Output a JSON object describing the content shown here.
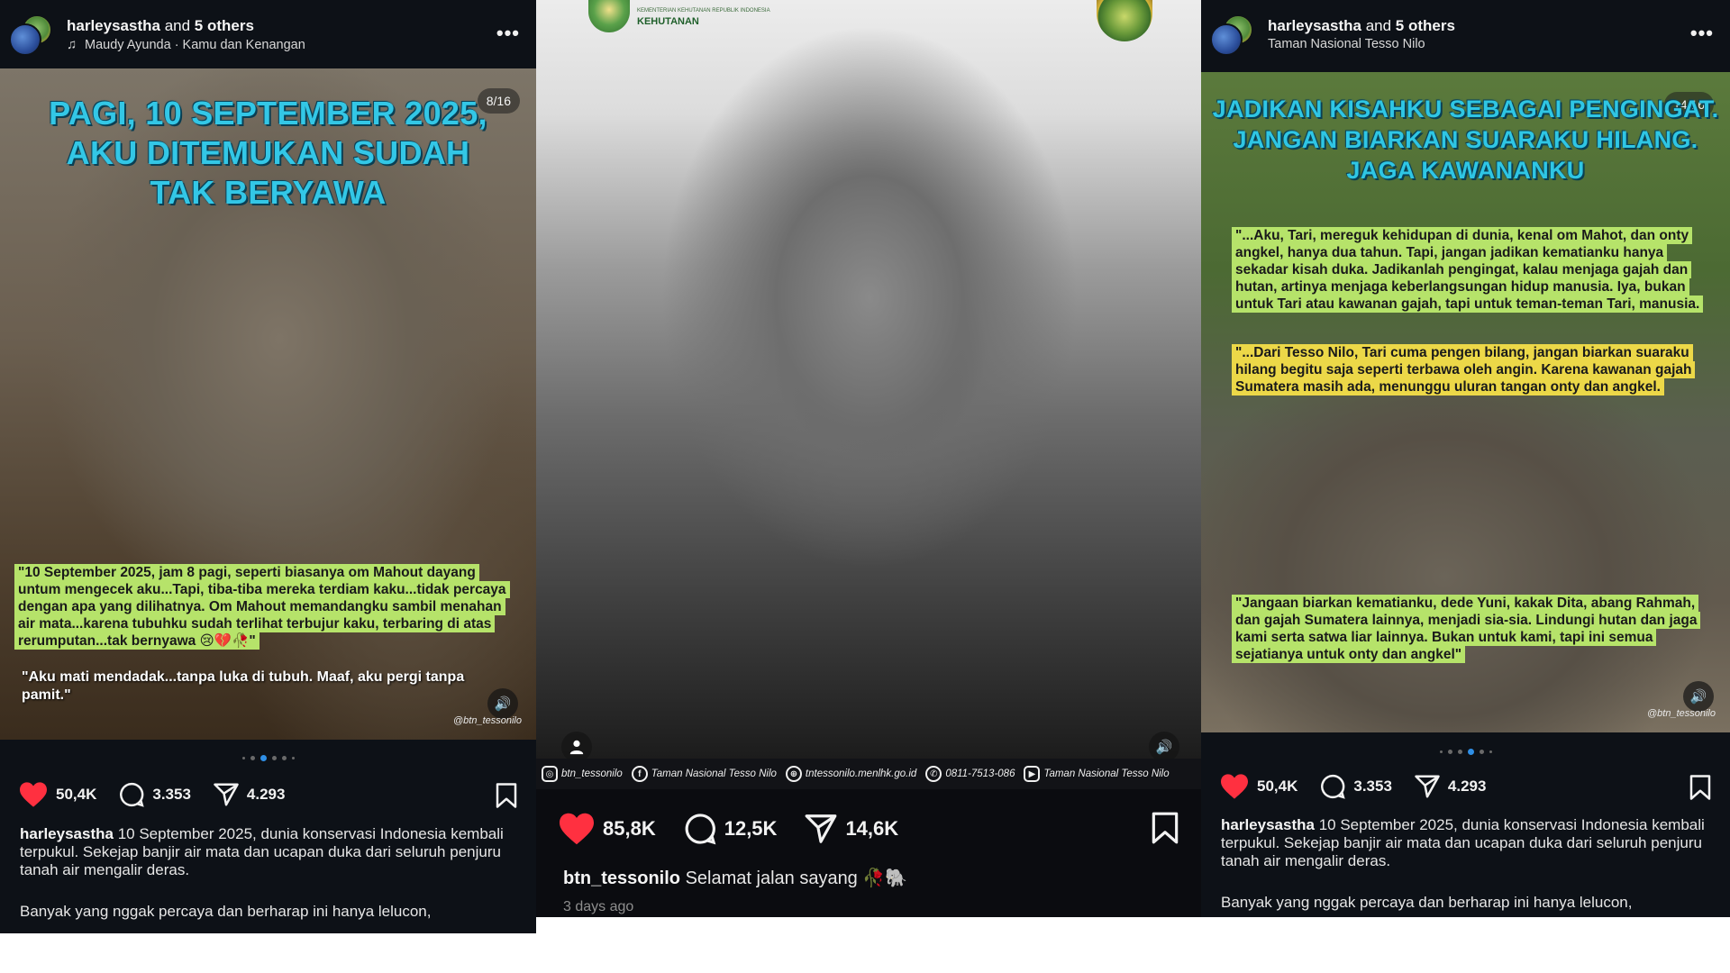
{
  "post1": {
    "header": {
      "user": "harleysastha",
      "and_text": "and",
      "others": "5 others",
      "music": "Maudy Ayunda · Kamu dan Kenangan"
    },
    "counter": "8/16",
    "headline": "PAGI, 10 SEPTEMBER 2025, AKU DITEMUKAN SUDAH TAK BERYAWA",
    "quote": "\"10 September 2025, jam 8 pagi, seperti biasanya om Mahout dayang untum mengecek aku...Tapi, tiba-tiba mereka terdiam kaku...tidak percaya dengan apa yang dilihatnya. Om Mahout memandangku sambil menahan air mata...karena tubuhku sudah terlihat terbujur kaku, terbaring di atas rerumputan...tak bernyawa 😢💔🥀\"",
    "quote2": "\"Aku mati mendadak...tanpa luka di tubuh. Maaf, aku pergi tanpa pamit.\"",
    "watermark": "@btn_tessonilo",
    "likes": "50,4K",
    "comments": "3.353",
    "shares": "4.293",
    "caption_user": "harleysastha",
    "caption_text": "10 September 2025, dunia konservasi Indonesia kembali terpukul. Sekejap banjir air mata dan ucapan duka dari seluruh penjuru tanah air mengalir deras.",
    "caption_more": "Banyak yang nggak percaya dan berharap ini hanya lelucon,"
  },
  "post2": {
    "logo_text": "KEHUTANAN",
    "logo_subtext": "KEMENTERIAN KEHUTANAN REPUBLIK INDONESIA",
    "info": {
      "instagram": "btn_tessonilo",
      "facebook": "Taman Nasional Tesso Nilo",
      "web": "tntessonilo.menlhk.go.id",
      "phone": "0811-7513-086",
      "youtube": "Taman Nasional Tesso Nilo"
    },
    "likes": "85,8K",
    "comments": "12,5K",
    "shares": "14,6K",
    "caption_user": "btn_tessonilo",
    "caption_text": "Selamat jalan sayang 🥀🐘",
    "time": "3 days ago"
  },
  "post3": {
    "header": {
      "user": "harleysastha",
      "and_text": "and",
      "others": "5 others",
      "location": "Taman Nasional Tesso Nilo"
    },
    "counter": "14/16",
    "headline": "JADIKAN KISAHKU SEBAGAI PENGINGAT. JANGAN BIARKAN SUARAKU HILANG. JAGA KAWANANKU",
    "quote1": "\"...Aku, Tari, mereguk kehidupan di dunia, kenal om Mahot, dan onty angkel, hanya dua tahun. Tapi, jangan jadikan kematianku hanya sekadar kisah duka. Jadikanlah pengingat, kalau menjaga gajah dan hutan, artinya menjaga keberlangsungan hidup manusia. Iya, bukan untuk Tari atau kawanan gajah, tapi untuk teman-teman Tari, manusia.",
    "quote2": "\"...Dari Tesso Nilo, Tari cuma pengen bilang, jangan biarkan suaraku hilang begitu saja seperti terbawa oleh angin. Karena kawanan gajah Sumatera masih ada, menunggu uluran tangan onty dan angkel.",
    "quote3": "\"Jangaan biarkan kematianku, dede Yuni, kakak Dita, abang Rahmah, dan gajah Sumatera lainnya, menjadi sia-sia. Lindungi hutan dan jaga kami serta satwa liar lainnya. Bukan untuk kami, tapi ini semua sejatianya untuk onty dan angkel\"",
    "watermark": "@btn_tessonilo",
    "likes": "50,4K",
    "comments": "3.353",
    "shares": "4.293",
    "caption_user": "harleysastha",
    "caption_text": "10 September 2025, dunia konservasi Indonesia kembali terpukul. Sekejap banjir air mata dan ucapan duka dari seluruh penjuru tanah air mengalir deras.",
    "caption_more": "Banyak yang nggak percaya dan berharap ini hanya lelucon,"
  },
  "colors": {
    "like": "#ff3040",
    "active_dot": "#2f8fe6",
    "headline": "#33c7e6",
    "quote_green": "#b6e36a",
    "quote_yellow": "#ecd848"
  },
  "icons": [
    "music-note-icon",
    "more-icon",
    "heart-icon",
    "comment-icon",
    "share-icon",
    "bookmark-icon",
    "sound-icon",
    "person-icon",
    "instagram-icon",
    "facebook-icon",
    "globe-icon",
    "phone-icon",
    "youtube-icon"
  ]
}
